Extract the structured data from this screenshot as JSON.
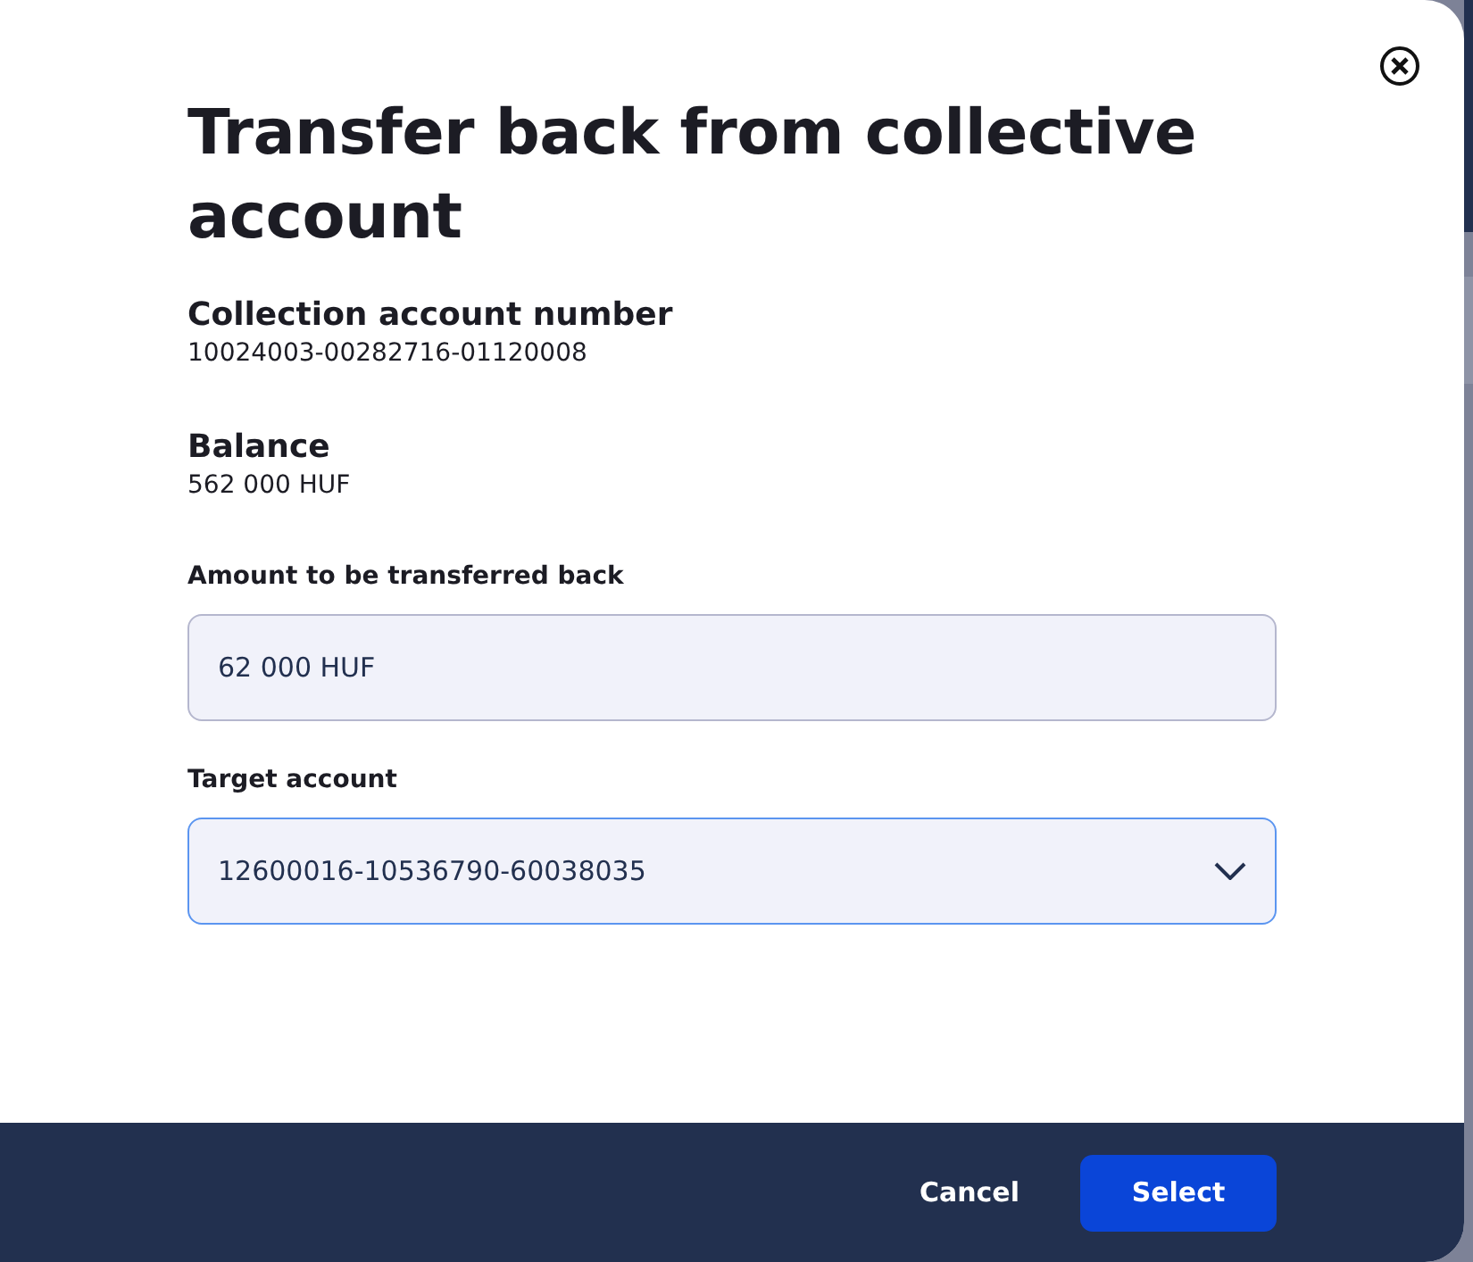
{
  "dialog": {
    "title": "Transfer back from collective account",
    "details": [
      {
        "label": "Collection account number",
        "value": "10024003-00282716-01120008"
      },
      {
        "label": "Balance",
        "value": "562 000 HUF"
      }
    ],
    "fields": [
      {
        "kind": "input",
        "label": "Amount to be transferred back",
        "value": "62 000 HUF",
        "focused": false
      },
      {
        "kind": "select",
        "label": "Target account",
        "value": "12600016-10536790-60038035",
        "focused": true
      }
    ],
    "buttons": [
      {
        "label": "Cancel",
        "primary": false
      },
      {
        "label": "Select",
        "primary": true
      }
    ]
  }
}
